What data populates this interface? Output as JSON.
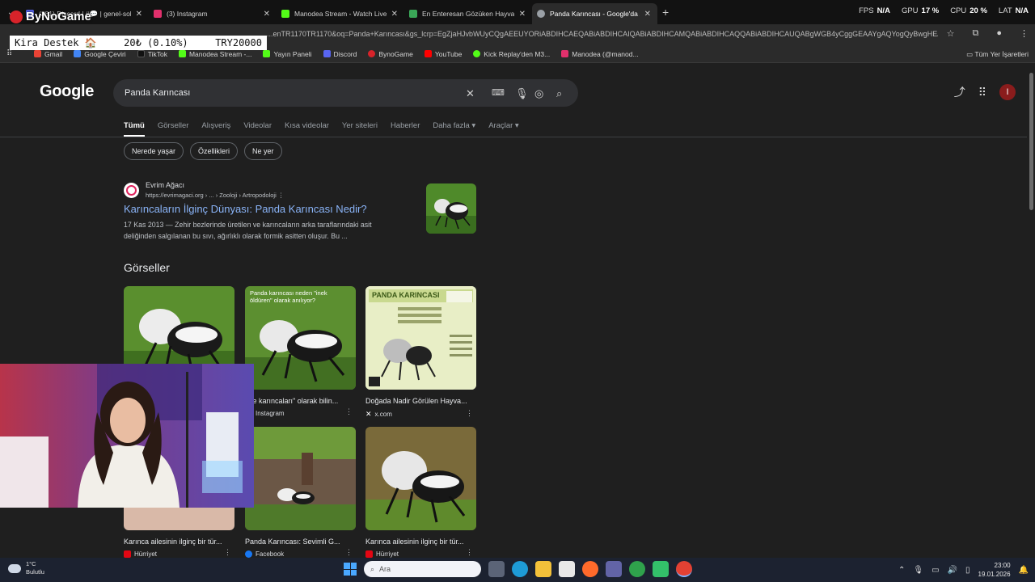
{
  "browser": {
    "tabs": [
      {
        "title": "(281) Discord | #💬 | genel-soh",
        "color": "#5865f2",
        "active": false
      },
      {
        "title": "(3) Instagram",
        "color": "#e1306c",
        "active": false
      },
      {
        "title": "Manodea Stream - Watch Live",
        "color": "#53fc18",
        "active": false
      },
      {
        "title": "En Enteresan Gözüken Hayvan",
        "color": "#3aa757",
        "active": false
      },
      {
        "title": "Panda Karıncası - Google'da Ar",
        "color": "#9aa0a6",
        "active": true
      }
    ],
    "new_tab": "+",
    "url": "...enTR1170TR1170&oq=Panda+Karıncası&gs_lcrp=EgZjaHJvbWUyCQgAEEUYORiABDIHCAEQABiABDIHCAIQABiABDIHCAMQABiABDIHCAQQABiABDIHCAUQABgWGB4yCggGEAAYgAQYogQyBwgHEAAY...",
    "bookmarks": [
      {
        "label": "Gmail",
        "color": "#ea4335"
      },
      {
        "label": "Google Çeviri",
        "color": "#4285f4"
      },
      {
        "label": "TikTok",
        "color": "#111111"
      },
      {
        "label": "Manodea Stream -...",
        "color": "#53fc18"
      },
      {
        "label": "Yayın Paneli",
        "color": "#53fc18"
      },
      {
        "label": "Discord",
        "color": "#5865f2"
      },
      {
        "label": "BynoGame",
        "color": "#d8232a"
      },
      {
        "label": "YouTube",
        "color": "#ff0000"
      },
      {
        "label": "Kick Replay'den M3...",
        "color": "#53fc18"
      },
      {
        "label": "Manodea (@manod...",
        "color": "#e1306c"
      }
    ],
    "all_bookmarks": "Tüm Yer İşaretleri"
  },
  "stats": {
    "fps_label": "FPS",
    "fps_value": "N/A",
    "gpu_label": "GPU",
    "gpu_value": "17 %",
    "cpu_label": "CPU",
    "cpu_value": "20 %",
    "lat_label": "LAT",
    "lat_value": "N/A"
  },
  "overlay": {
    "brand": "ByNoGame",
    "goal_label": "Kira Destek 🏠",
    "goal_progress": "20₺ (0.10%)",
    "goal_target": "TRY20000"
  },
  "google": {
    "logo": "Google",
    "query": "Panda Karıncası",
    "avatar_letter": "I",
    "tabs": [
      "Tümü",
      "Görseller",
      "Alışveriş",
      "Videolar",
      "Kısa videolar",
      "Yer siteleri",
      "Haberler",
      "Daha fazla ▾",
      "Araçlar ▾"
    ],
    "chips": [
      "Nerede yaşar",
      "Özellikleri",
      "Ne yer"
    ]
  },
  "result": {
    "site": "Evrim Ağacı",
    "crumb": "https://evrimagaci.org › ... › Zooloji › Artropodoloji  ⋮",
    "title": "Karıncaların İlginç Dünyası: Panda Karıncası Nedir?",
    "snippet": "17 Kas 2013 — Zehir bezlerinde üretilen ve karıncaların arka taraflarındaki asit deliğinden salgılanan bu sıvı, ağırlıklı olarak formik asitten oluşur. Bu ..."
  },
  "images": {
    "heading": "Görseller",
    "cards": [
      {
        "caption": "",
        "source": "",
        "color": "#e1306c"
      },
      {
        "caption": "dife karıncaları\" olarak bilin...",
        "source": "Instagram",
        "color": "#e1306c",
        "overlay_text": "Panda karıncası neden \"inek öldüren\" olarak anılıyor?"
      },
      {
        "caption": "Doğada Nadir Görülen Hayva...",
        "source": "x.com",
        "color": "#ffffff",
        "overlay_text": "PANDA KARINCASI"
      },
      {
        "caption": "Karınca ailesinin ilginç bir tür...",
        "source": "Hürriyet",
        "color": "#e30613"
      },
      {
        "caption": "Panda Karıncası: Sevimli G...",
        "source": "Facebook",
        "color": "#1877f2"
      },
      {
        "caption": "Karınca ailesinin ilginç bir tür...",
        "source": "Hürriyet",
        "color": "#e30613"
      }
    ]
  },
  "taskbar": {
    "temp": "1°C",
    "weather": "Bulutlu",
    "search_placeholder": "Ara",
    "time": "23:00",
    "date": "19.01.2026"
  }
}
